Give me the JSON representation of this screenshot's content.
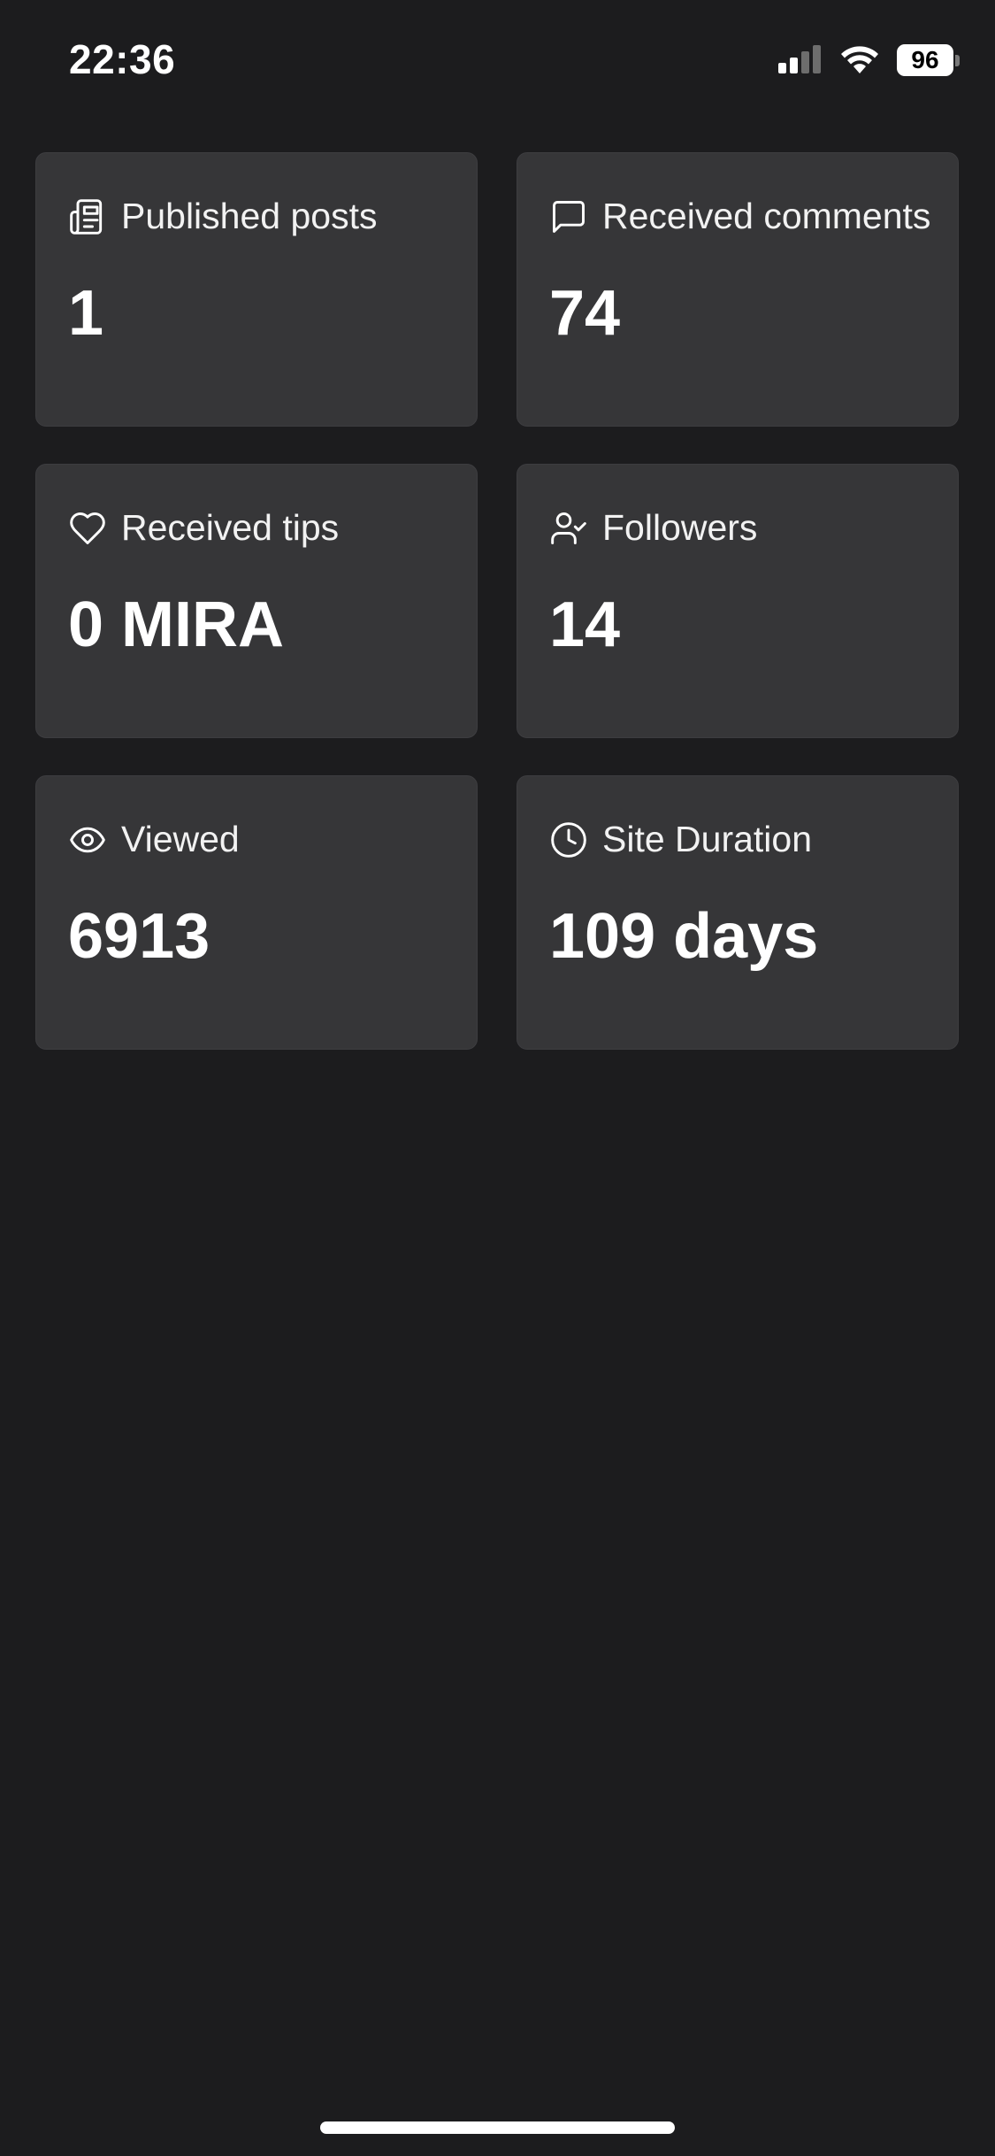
{
  "status_bar": {
    "time": "22:36",
    "battery_level": "96",
    "signal_icon": "cellular-signal-icon",
    "wifi_icon": "wifi-icon"
  },
  "stats": [
    {
      "icon": "newspaper-icon",
      "label": "Published posts",
      "value": "1"
    },
    {
      "icon": "chat-bubble-icon",
      "label": "Received comments",
      "value": "74"
    },
    {
      "icon": "heart-icon",
      "label": "Received tips",
      "value": "0 MIRA"
    },
    {
      "icon": "user-check-icon",
      "label": "Followers",
      "value": "14"
    },
    {
      "icon": "eye-icon",
      "label": "Viewed",
      "value": "6913"
    },
    {
      "icon": "clock-icon",
      "label": "Site Duration",
      "value": "109 days"
    }
  ],
  "colors": {
    "background": "#1c1c1e",
    "card": "#363638",
    "text": "#ffffff"
  }
}
